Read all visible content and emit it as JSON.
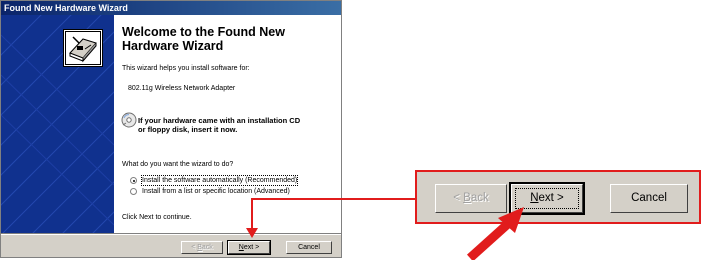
{
  "window": {
    "title": "Found New Hardware Wizard"
  },
  "wizard": {
    "heading_line1": "Welcome to the Found New",
    "heading_line2": "Hardware Wizard",
    "intro": "This wizard helps you install software for:",
    "device": "802.11g Wireless Network Adapter",
    "cd_line1": "If your hardware came with an installation CD",
    "cd_line2": "or floppy disk, insert it now.",
    "question": "What do you want the wizard to do?",
    "options": [
      {
        "label": "Install the software automatically (Recommended)",
        "selected": true
      },
      {
        "label": "Install from a list or specific location (Advanced)",
        "selected": false
      }
    ],
    "footer_note": "Click Next to continue."
  },
  "buttons": {
    "back_prefix": "< ",
    "back_key": "B",
    "back_rest": "ack",
    "next_key": "N",
    "next_rest": "ext >",
    "cancel": "Cancel"
  },
  "zoom": {
    "back_prefix": "< ",
    "back_key": "B",
    "back_rest": "ack",
    "next_key": "N",
    "next_rest": "ext >",
    "cancel": "Cancel"
  },
  "colors": {
    "highlight": "#e11c1c",
    "sidepanel": "#10318e",
    "titlebar": "#0a246a"
  }
}
